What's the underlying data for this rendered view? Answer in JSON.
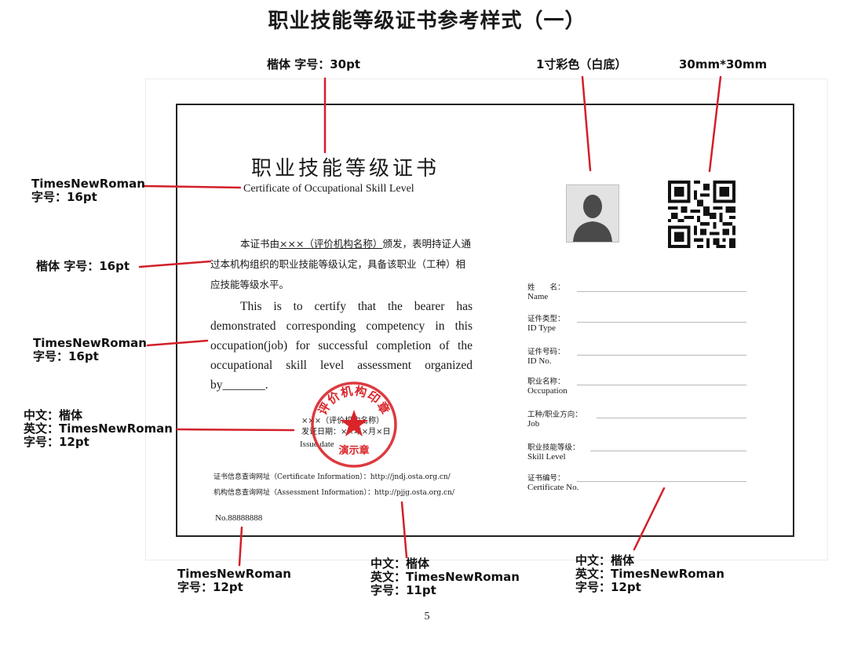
{
  "page": {
    "title": "职业技能等级证书参考样式（一）",
    "page_number": "5"
  },
  "annotations": {
    "title_font": "楷体 字号：30pt",
    "photo_spec": "1寸彩色（白底）",
    "qr_spec": "30mm*30mm",
    "en_title_font": "TimesNewRoman\n字号：16pt",
    "cn_body_font": "楷体 字号：16pt",
    "en_body_font": "TimesNewRoman\n字号：16pt",
    "issuer_font": "中文：楷体\n英文：TimesNewRoman\n字号：12pt",
    "cert_no_font": "TimesNewRoman\n字号：12pt",
    "info_font": "中文：楷体\n英文：TimesNewRoman\n字号：11pt",
    "fields_font": "中文：楷体\n英文：TimesNewRoman\n字号：12pt"
  },
  "certificate": {
    "title_cn": "职业技能等级证书",
    "title_en": "Certificate of Occupational Skill Level",
    "body_cn_prefix": "本证书由",
    "body_cn_org": "×××（评价机构名称）",
    "body_cn_suffix": "颁发，表明持证人通过本机构组织的职业技能等级认定，具备该职业（工种）相应技能等级水平。",
    "body_en": "This is to certify that the bearer has demonstrated corresponding competency in this occupation(job) for successful completion of the occupational skill level assessment organized by_______.",
    "issuer_name": "×××（评价机构名称）",
    "issue_date_cn": "发证日期：××年×月×日",
    "issue_date_en": "Issue date",
    "stamp_arc": "评价机构印章",
    "stamp_bottom": "演示章",
    "info_line_1": "证书信息查询网址（Certificate Information）：http://jndj.osta.org.cn/",
    "info_line_2": "机构信息查询网址（Assessment Information）：http://pjjg.osta.org.cn/",
    "cert_no": "No.88888888",
    "fields": [
      {
        "cn": "姓　　名：",
        "en": "Name"
      },
      {
        "cn": "证件类型：",
        "en": "ID Type"
      },
      {
        "cn": "证件号码：",
        "en": "ID No."
      },
      {
        "cn": "职业名称：",
        "en": "Occupation"
      },
      {
        "cn": "工种/职业方向：",
        "en": "Job"
      },
      {
        "cn": "职业技能等级：",
        "en": "Skill Level"
      },
      {
        "cn": "证书编号：",
        "en": "Certificate No."
      }
    ]
  },
  "colors": {
    "annotation_line": "#d2202a",
    "stamp": "#d9252a"
  }
}
